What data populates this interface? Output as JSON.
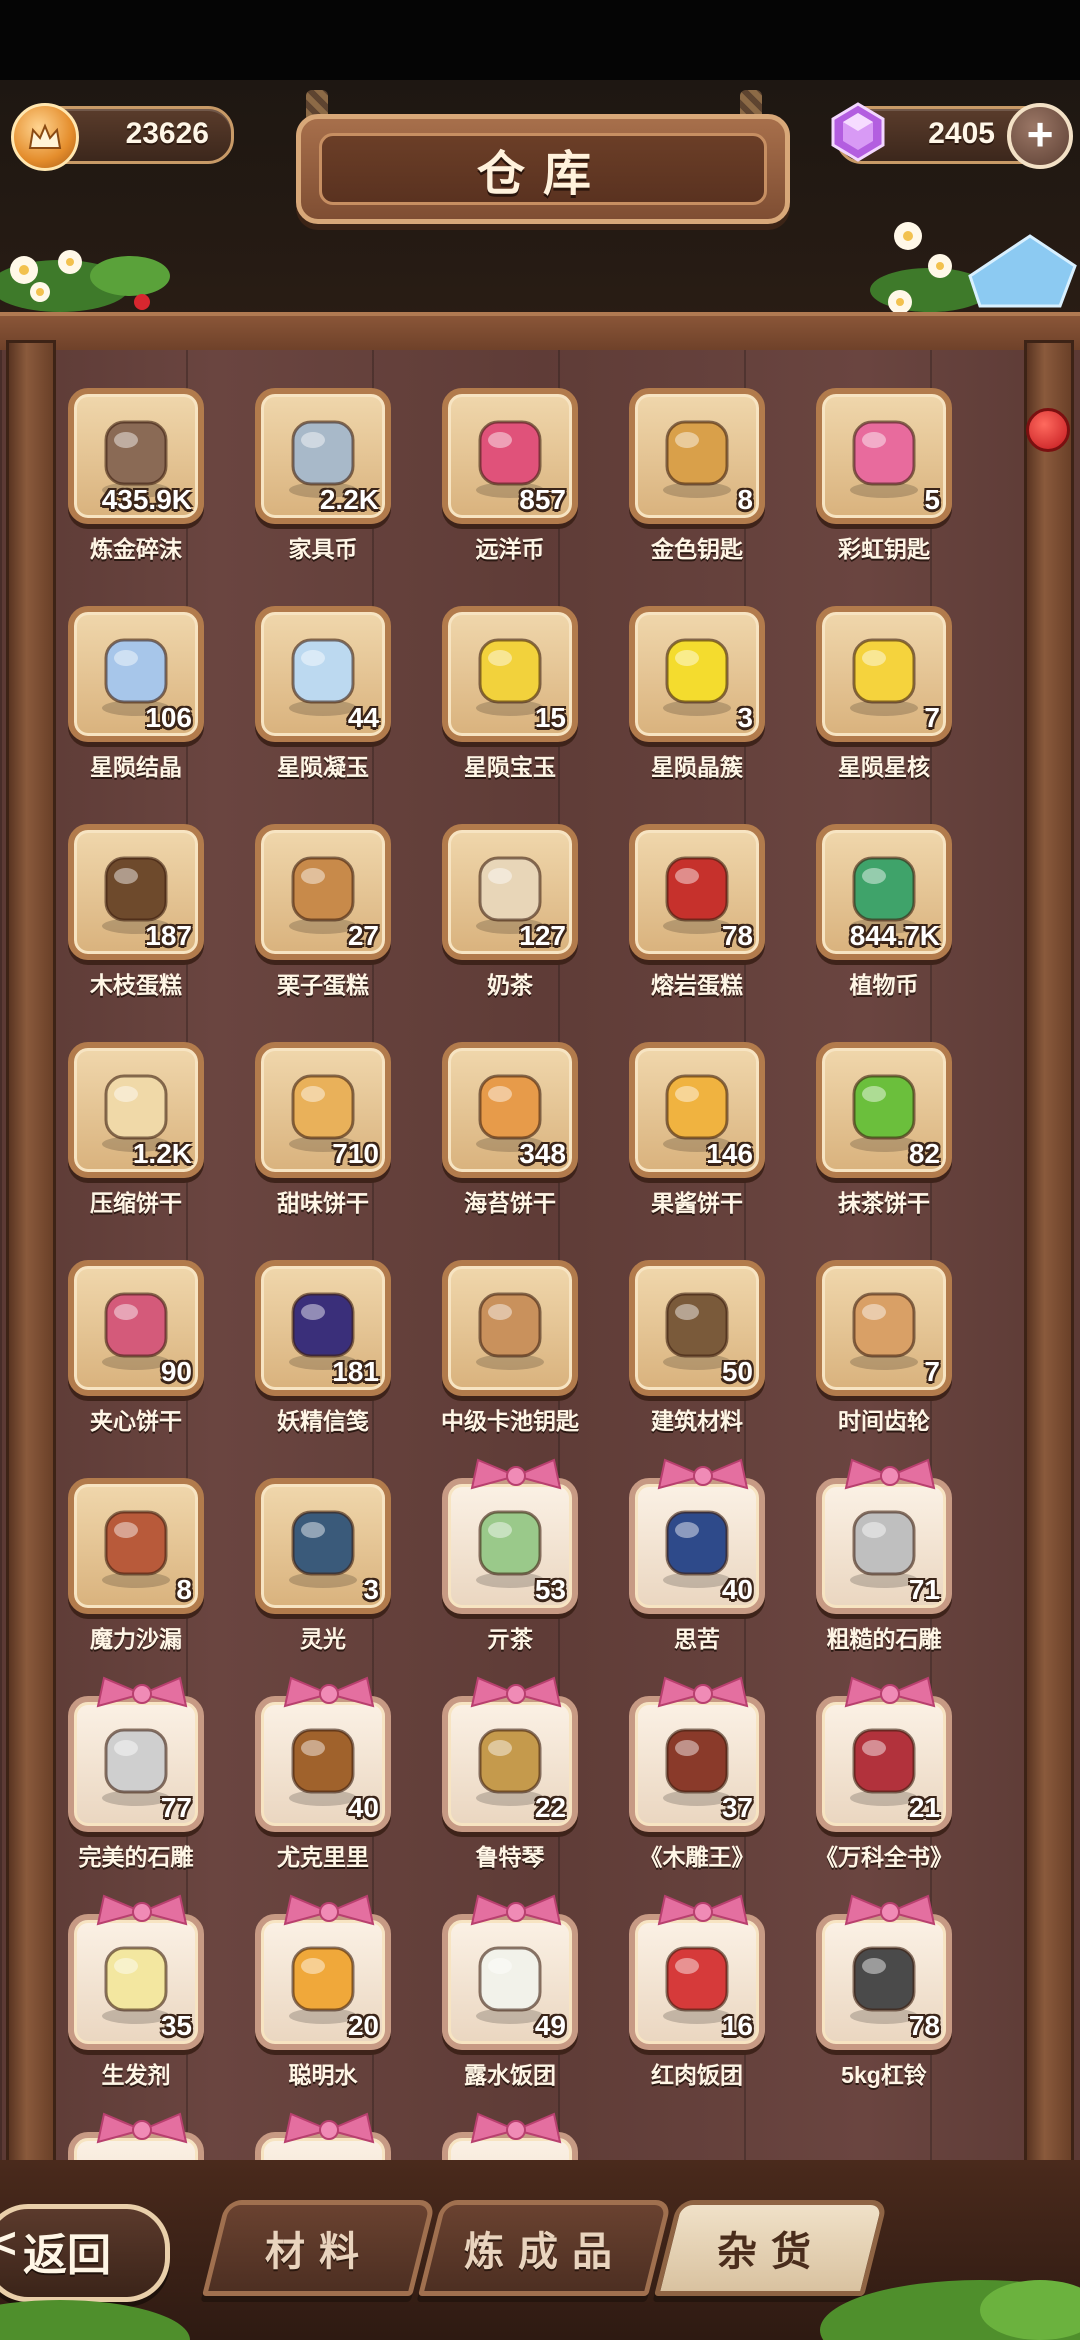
{
  "header": {
    "title": "仓库",
    "gold_amount": "23626",
    "gem_amount": "2405",
    "add_gem_symbol": "+"
  },
  "items": [
    {
      "name": "炼金碎沫",
      "count": "435.9K",
      "icon": "rock-ore-icon",
      "gift": false
    },
    {
      "name": "家具币",
      "count": "2.2K",
      "icon": "furniture-coin-icon",
      "gift": false
    },
    {
      "name": "远洋币",
      "count": "857",
      "icon": "ship-coin-icon",
      "gift": false
    },
    {
      "name": "金色钥匙",
      "count": "8",
      "icon": "gold-key-icon",
      "gift": false
    },
    {
      "name": "彩虹钥匙",
      "count": "5",
      "icon": "rainbow-key-icon",
      "gift": false
    },
    {
      "name": "星陨结晶",
      "count": "106",
      "icon": "blue-crystal-icon",
      "gift": false
    },
    {
      "name": "星陨凝玉",
      "count": "44",
      "icon": "blue-star-icon",
      "gift": false
    },
    {
      "name": "星陨宝玉",
      "count": "15",
      "icon": "yellow-crystal-icon",
      "gift": false
    },
    {
      "name": "星陨晶簇",
      "count": "3",
      "icon": "yellow-star-icon",
      "gift": false
    },
    {
      "name": "星陨星核",
      "count": "7",
      "icon": "star-core-icon",
      "gift": false
    },
    {
      "name": "木枝蛋糕",
      "count": "187",
      "icon": "log-cake-icon",
      "gift": false
    },
    {
      "name": "栗子蛋糕",
      "count": "27",
      "icon": "chestnut-cake-icon",
      "gift": false
    },
    {
      "name": "奶茶",
      "count": "127",
      "icon": "milk-tea-icon",
      "gift": false
    },
    {
      "name": "熔岩蛋糕",
      "count": "78",
      "icon": "lava-cake-icon",
      "gift": false
    },
    {
      "name": "植物币",
      "count": "844.7K",
      "icon": "plant-coin-icon",
      "gift": false
    },
    {
      "name": "压缩饼干",
      "count": "1.2K",
      "icon": "cube-biscuit-icon",
      "gift": false
    },
    {
      "name": "甜味饼干",
      "count": "710",
      "icon": "sweet-biscuit-icon",
      "gift": false
    },
    {
      "name": "海苔饼干",
      "count": "348",
      "icon": "seaweed-biscuit-icon",
      "gift": false
    },
    {
      "name": "果酱饼干",
      "count": "146",
      "icon": "jam-biscuit-icon",
      "gift": false
    },
    {
      "name": "抹茶饼干",
      "count": "82",
      "icon": "matcha-biscuit-icon",
      "gift": false
    },
    {
      "name": "夹心饼干",
      "count": "90",
      "icon": "sandwich-biscuit-icon",
      "gift": false
    },
    {
      "name": "妖精信笺",
      "count": "181",
      "icon": "fairy-letter-icon",
      "gift": false
    },
    {
      "name": "中级卡池钥匙",
      "count": "",
      "icon": "copper-key-icon",
      "gift": false
    },
    {
      "name": "建筑材料",
      "count": "50",
      "icon": "building-material-icon",
      "gift": false
    },
    {
      "name": "时间齿轮",
      "count": "7",
      "icon": "gear-icon",
      "gift": false
    },
    {
      "name": "魔力沙漏",
      "count": "8",
      "icon": "hourglass-icon",
      "gift": false
    },
    {
      "name": "灵光",
      "count": "3",
      "icon": "lightbulb-icon",
      "gift": false
    },
    {
      "name": "亓茶",
      "count": "53",
      "icon": "tea-bowl-icon",
      "gift": true
    },
    {
      "name": "思苦",
      "count": "40",
      "icon": "porcelain-cup-icon",
      "gift": true
    },
    {
      "name": "粗糙的石雕",
      "count": "71",
      "icon": "rough-statue-icon",
      "gift": true
    },
    {
      "name": "完美的石雕",
      "count": "77",
      "icon": "perfect-statue-icon",
      "gift": true
    },
    {
      "name": "尤克里里",
      "count": "40",
      "icon": "ukulele-icon",
      "gift": true
    },
    {
      "name": "鲁特琴",
      "count": "22",
      "icon": "lute-icon",
      "gift": true
    },
    {
      "name": "《木雕王》",
      "count": "37",
      "icon": "brown-book-icon",
      "gift": true
    },
    {
      "name": "《万科全书》",
      "count": "21",
      "icon": "red-book-icon",
      "gift": true
    },
    {
      "name": "生发剂",
      "count": "35",
      "icon": "potion-bottle-icon",
      "gift": true
    },
    {
      "name": "聪明水",
      "count": "20",
      "icon": "smart-potion-icon",
      "gift": true
    },
    {
      "name": "露水饭团",
      "count": "49",
      "icon": "rice-ball-icon",
      "gift": true
    },
    {
      "name": "红肉饭团",
      "count": "16",
      "icon": "red-rice-ball-icon",
      "gift": true
    },
    {
      "name": "5kg杠铃",
      "count": "78",
      "icon": "dumbbell-icon",
      "gift": true
    },
    {
      "name": "",
      "count": "",
      "icon": "partial-item-icon",
      "gift": true
    },
    {
      "name": "",
      "count": "",
      "icon": "partial-item-icon",
      "gift": true
    },
    {
      "name": "",
      "count": "",
      "icon": "partial-item-icon",
      "gift": true
    }
  ],
  "tabs": [
    {
      "label": "材料",
      "active": false
    },
    {
      "label": "炼成品",
      "active": false
    },
    {
      "label": "杂货",
      "active": true
    }
  ],
  "back_label": "返回",
  "back_chevron": "<"
}
